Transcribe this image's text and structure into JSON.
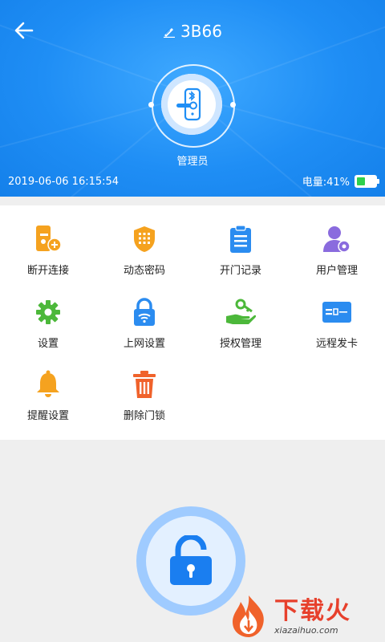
{
  "header": {
    "back_icon": "arrow-left-icon",
    "edit_icon": "pencil-icon",
    "title": "3B66",
    "role": "管理员",
    "datetime": "2019-06-06 16:15:54",
    "battery_label": "电量:41%",
    "battery_level": 0.41,
    "battery_color": "#2fd04d"
  },
  "menu": {
    "items": [
      {
        "label": "断开连接",
        "icon": "disconnect-key-icon",
        "color": "#f5a21f"
      },
      {
        "label": "动态密码",
        "icon": "keypad-shield-icon",
        "color": "#f5a21f"
      },
      {
        "label": "开门记录",
        "icon": "clipboard-list-icon",
        "color": "#2b8cf0"
      },
      {
        "label": "用户管理",
        "icon": "user-gear-icon",
        "color": "#8a6bde"
      },
      {
        "label": "设置",
        "icon": "gear-icon",
        "color": "#4cb83a"
      },
      {
        "label": "上网设置",
        "icon": "wifi-lock-icon",
        "color": "#2b8cf0"
      },
      {
        "label": "授权管理",
        "icon": "hand-key-icon",
        "color": "#4cb83a"
      },
      {
        "label": "远程发卡",
        "icon": "card-icon",
        "color": "#2b8cf0"
      },
      {
        "label": "提醒设置",
        "icon": "bell-icon",
        "color": "#f5a21f"
      },
      {
        "label": "删除门锁",
        "icon": "trash-icon",
        "color": "#f0622b"
      }
    ]
  },
  "unlock": {
    "icon": "unlock-padlock-icon",
    "color": "#1a7ef0"
  },
  "watermark": {
    "cn": "下载火",
    "en": "xiazaihuo.com"
  },
  "colors": {
    "header_blue": "#1f8ef5",
    "background": "#efefef"
  }
}
